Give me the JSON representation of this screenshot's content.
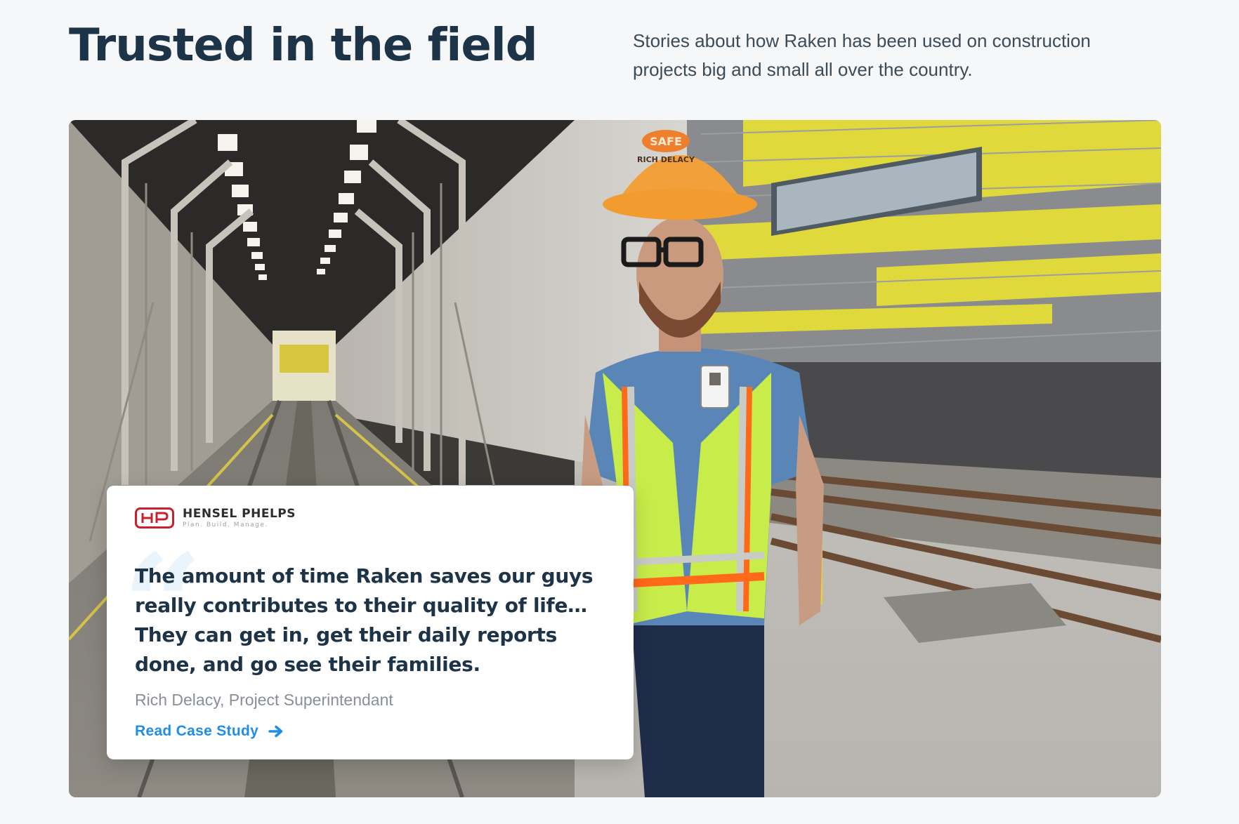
{
  "header": {
    "title": "Trusted in the field",
    "subtitle": "Stories about how Raken has been used on construction projects big and small all over the country."
  },
  "hero": {
    "photo_subject": "construction superintendent in hard hat and safety vest at rail facility",
    "hard_hat_text": "RICH DELACY",
    "hard_hat_badge": "SAFE"
  },
  "testimonial": {
    "company_name": "HENSEL PHELPS",
    "company_tagline": "Plan. Build. Manage.",
    "quote_mark": "“",
    "quote": "The amount of time Raken saves our guys really contributes to their quality of life… They can get in, get their daily reports done, and go see their families.",
    "attribution": "Rich Delacy, Project Superintendant",
    "cta_label": "Read Case Study",
    "cta_icon": "arrow-right-icon"
  },
  "colors": {
    "background": "#f6f7f9",
    "heading": "#1d3347",
    "accent": "#1f8ee6",
    "brand_red": "#c8202f"
  }
}
